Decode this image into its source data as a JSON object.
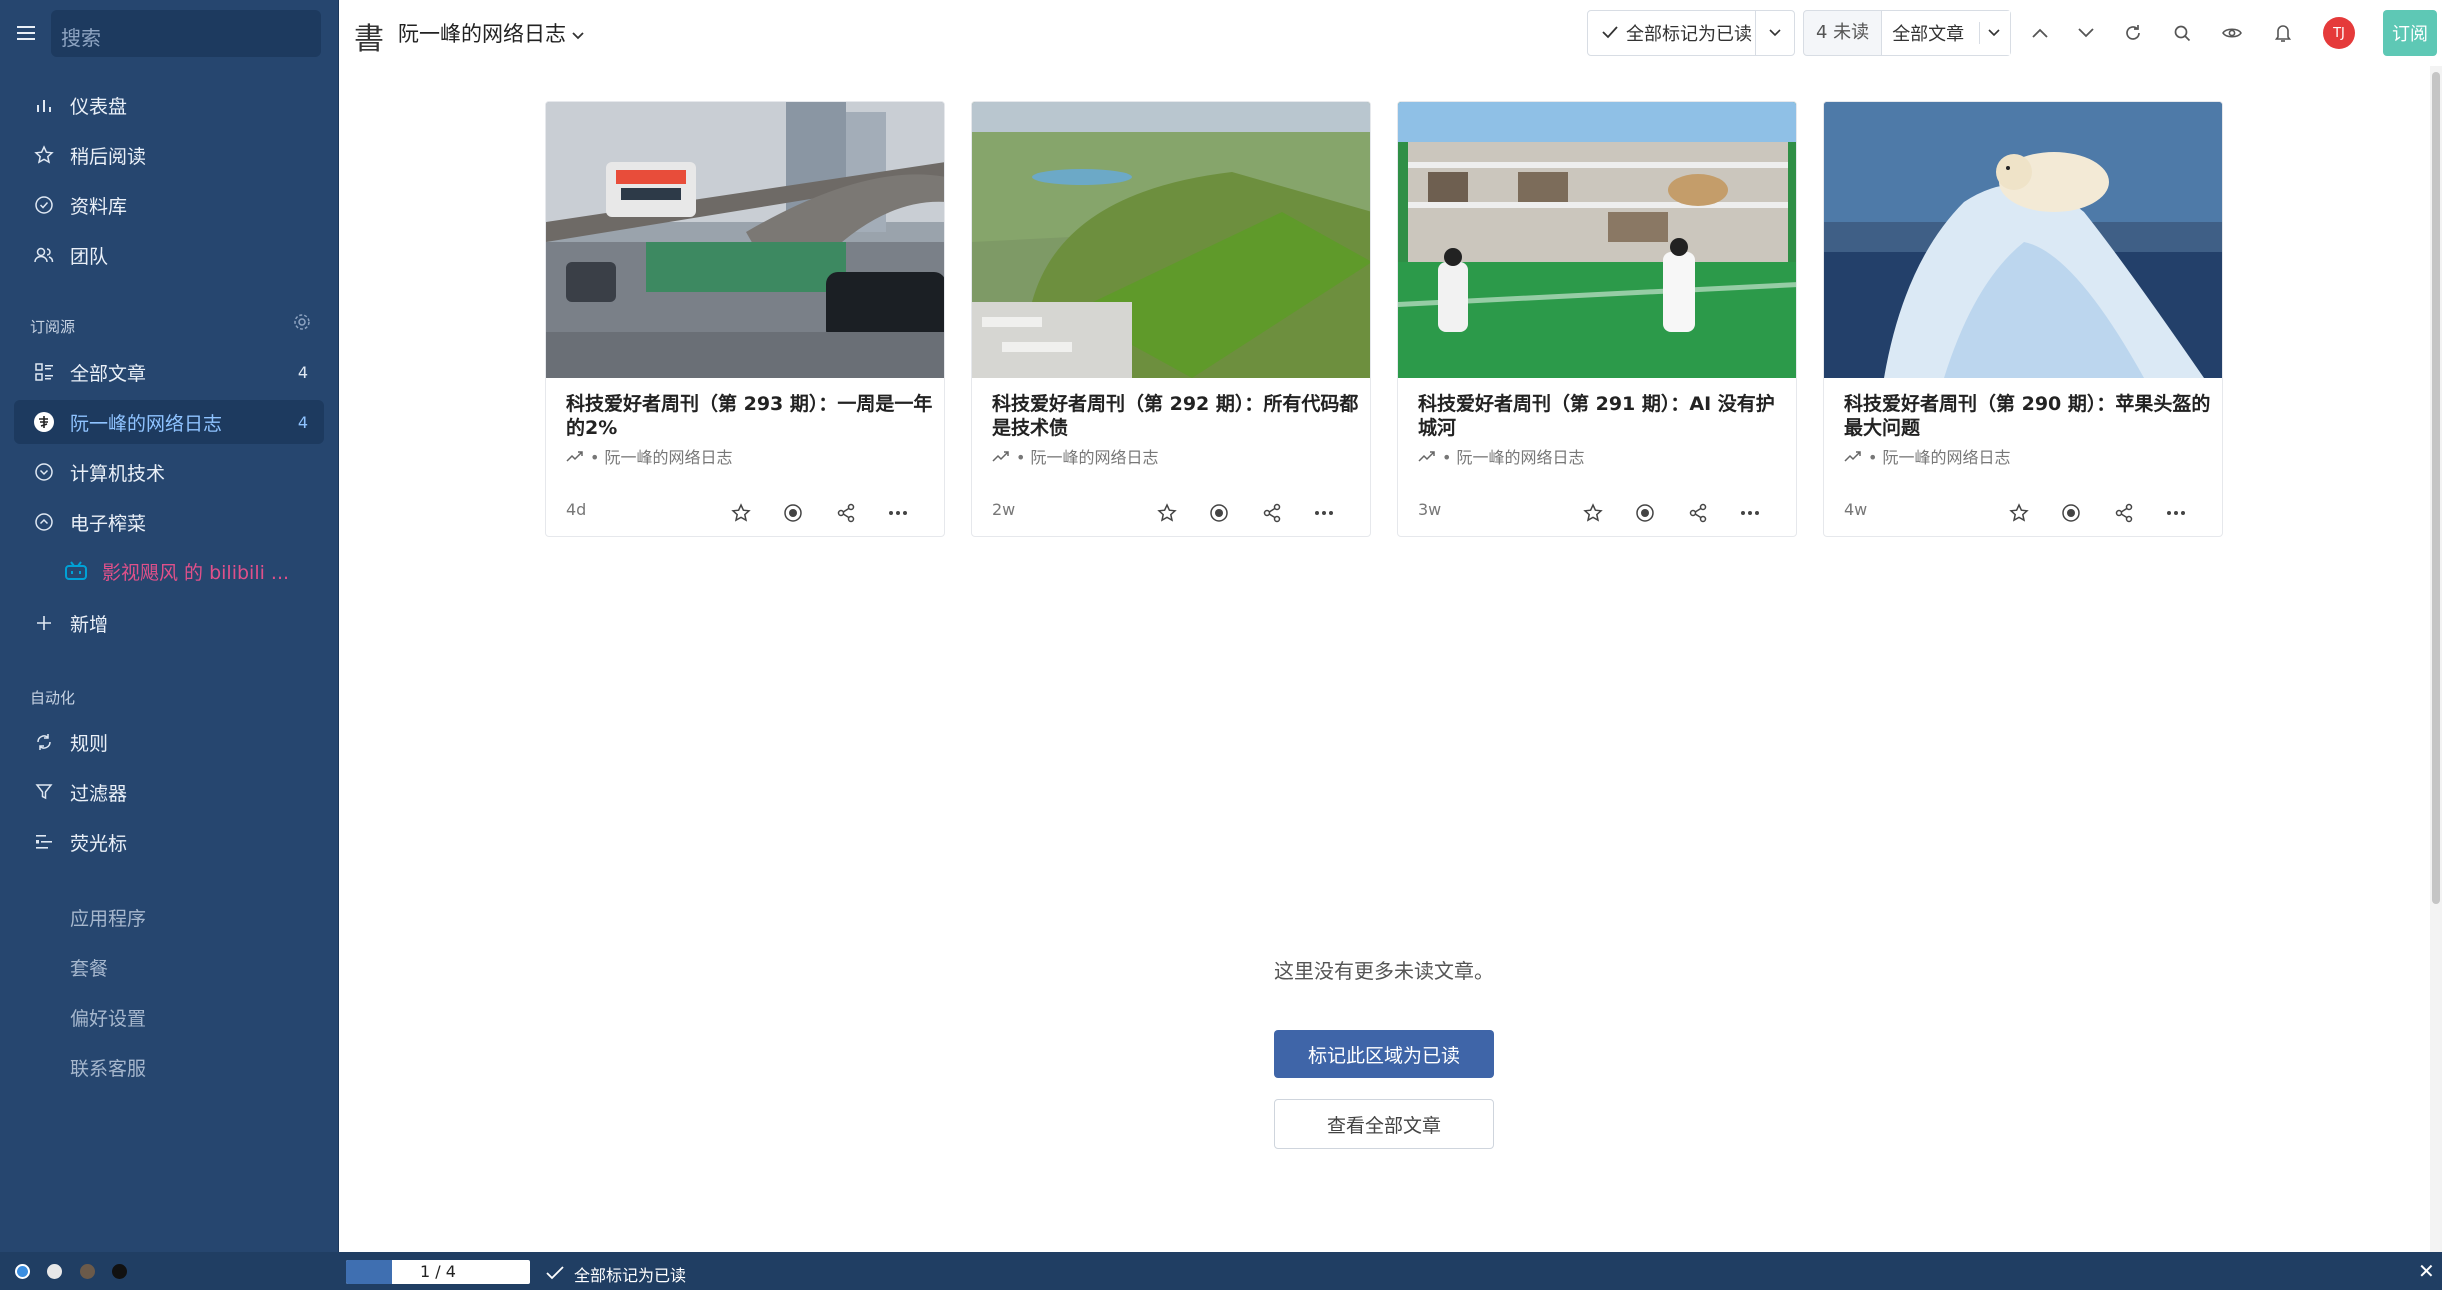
{
  "sidebar": {
    "search_placeholder": "搜索",
    "main": [
      {
        "label": "仪表盘",
        "icon": "dashboard-icon"
      },
      {
        "label": "稍后阅读",
        "icon": "star-icon"
      },
      {
        "label": "资料库",
        "icon": "library-icon"
      },
      {
        "label": "团队",
        "icon": "team-icon"
      }
    ],
    "subscriptions_label": "订阅源",
    "feeds": [
      {
        "label": "全部文章",
        "count": "4",
        "icon": "all-articles-icon"
      },
      {
        "label": "阮一峰的网络日志",
        "count": "4",
        "icon": "feed-logo-icon"
      },
      {
        "label": "计算机技术",
        "count": "",
        "icon": "folder-collapsed-icon"
      },
      {
        "label": "电子榨菜",
        "count": "",
        "icon": "folder-expanded-icon"
      },
      {
        "label": "影视飓风 的 bilibili ...",
        "count": "",
        "icon": "bilibili-icon"
      },
      {
        "label": "新增",
        "count": "",
        "icon": "plus-icon"
      }
    ],
    "automation_label": "自动化",
    "automation": [
      {
        "label": "规则",
        "icon": "rules-icon"
      },
      {
        "label": "过滤器",
        "icon": "filter-icon"
      },
      {
        "label": "荧光标",
        "icon": "highlight-icon"
      }
    ],
    "links": [
      {
        "label": "应用程序"
      },
      {
        "label": "套餐"
      },
      {
        "label": "偏好设置"
      },
      {
        "label": "联系客服"
      }
    ]
  },
  "topbar": {
    "feed_title": "阮一峰的网络日志",
    "mark_all_read": "全部标记为已读",
    "unread_count": "4 未读",
    "filter_label": "全部文章",
    "avatar_initials": "TJ",
    "subscribe_label": "订阅"
  },
  "articles": [
    {
      "title": "科技爱好者周刊（第 293 期）：一周是一年的2%",
      "source": "• 阮一峰的网络日志",
      "age": "4d",
      "image": "monorail"
    },
    {
      "title": "科技爱好者周刊（第 292 期）：所有代码都是技术债",
      "source": "• 阮一峰的网络日志",
      "age": "2w",
      "image": "green-roof"
    },
    {
      "title": "科技爱好者周刊（第 291 期）：AI 没有护城河",
      "source": "• 阮一峰的网络日志",
      "age": "3w",
      "image": "school-field"
    },
    {
      "title": "科技爱好者周刊（第 290 期）：苹果头盔的最大问题",
      "source": "• 阮一峰的网络日志",
      "age": "4w",
      "image": "polar-bear"
    }
  ],
  "main": {
    "empty_message": "这里没有更多未读文章。",
    "mark_area_read": "标记此区域为已读",
    "view_all": "查看全部文章"
  },
  "statusbar": {
    "page_indicator": "1 / 4",
    "progress": 0.25,
    "mark_all_read": "全部标记为已读",
    "close": "✕"
  },
  "colors": {
    "sidebar_bg": "#26466f",
    "accent": "#3f65a8",
    "subscribe": "#5ec8b5",
    "bilibili": "#e0508a"
  }
}
